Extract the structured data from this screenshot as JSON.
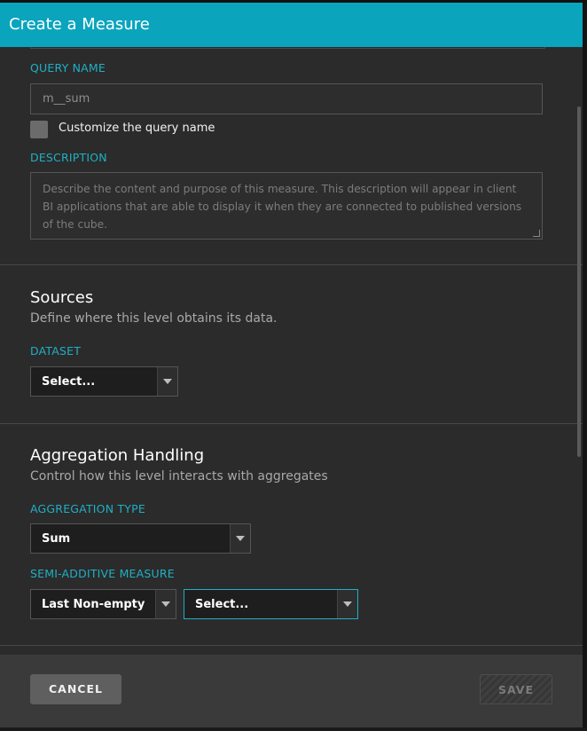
{
  "dialog": {
    "title": "Create a Measure"
  },
  "query_name": {
    "label": "QUERY NAME",
    "value": "m__sum",
    "customize_label": "Customize the query name"
  },
  "description": {
    "label": "DESCRIPTION",
    "placeholder": "Describe the content and purpose of this measure. This description will appear in client BI applications that are able to display it when they are connected to published versions of the cube."
  },
  "sources": {
    "title": "Sources",
    "subtitle": "Define where this level obtains its data.",
    "dataset_label": "DATASET",
    "dataset_value": "Select..."
  },
  "aggregation": {
    "title": "Aggregation Handling",
    "subtitle": "Control how this level interacts with aggregates",
    "type_label": "AGGREGATION TYPE",
    "type_value": "Sum",
    "semi_label": "SEMI-ADDITIVE MEASURE",
    "semi_value": "Last Non-empty",
    "semi_secondary_value": "Select..."
  },
  "footer": {
    "cancel_label": "CANCEL",
    "save_label": "SAVE"
  },
  "colors": {
    "accent": "#0aa4bd",
    "label": "#1fb0c4",
    "panel": "#2b2b2b",
    "footer": "#3a3a3a"
  }
}
